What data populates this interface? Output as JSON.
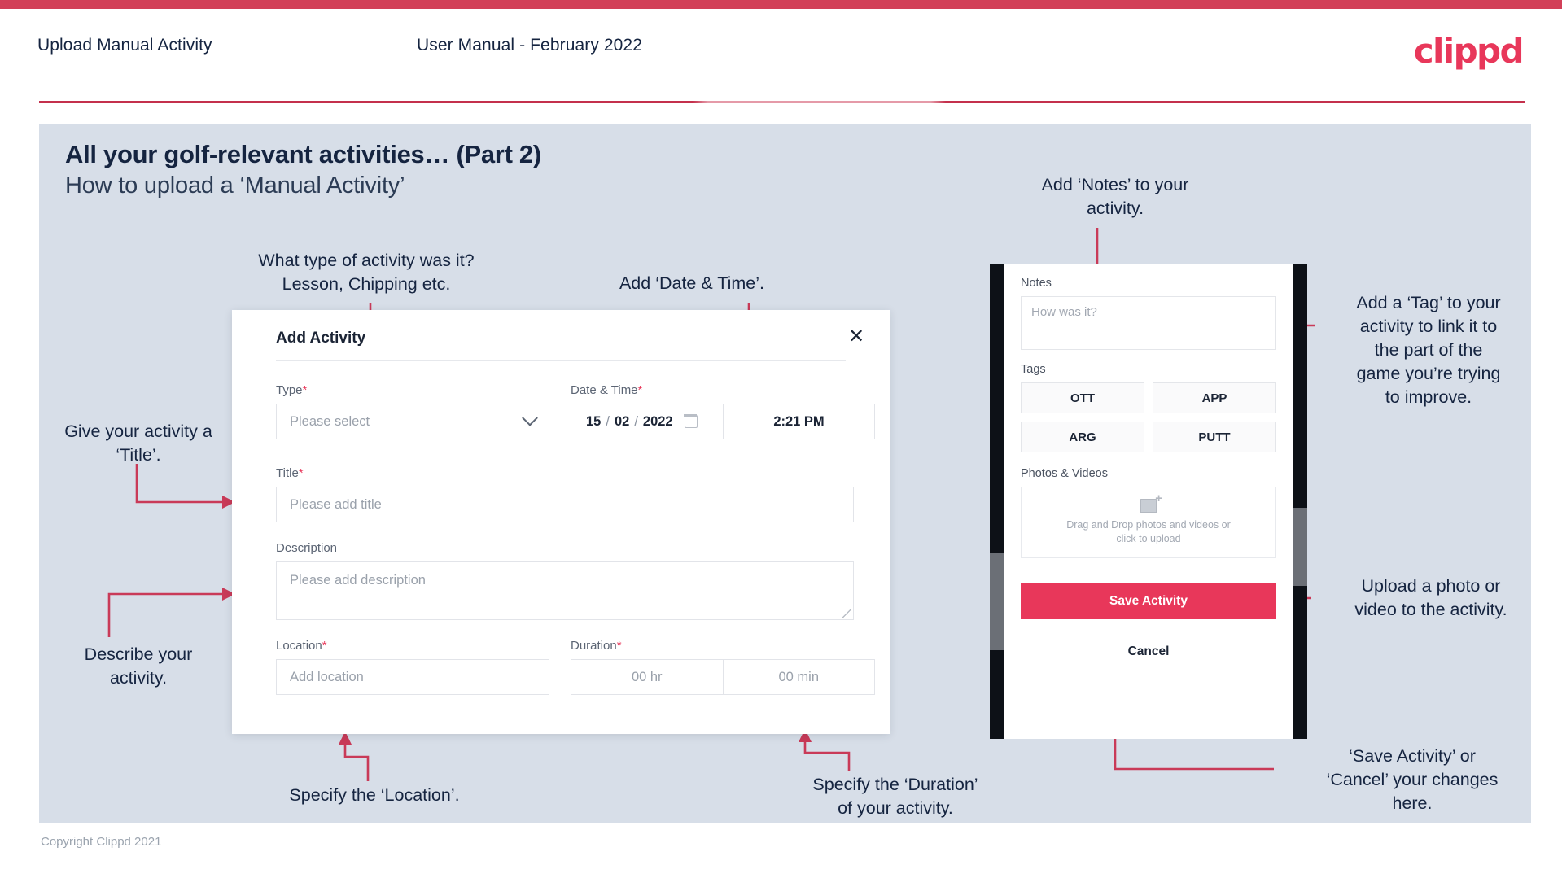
{
  "header": {
    "title": "Upload Manual Activity",
    "subtitle": "User Manual - February 2022",
    "brand": "clippd"
  },
  "slide": {
    "title": "All your golf-relevant activities… (Part 2)",
    "subtitle": "How to upload a ‘Manual Activity’",
    "copyright": "Copyright Clippd 2021"
  },
  "annotations": {
    "type": "What type of activity was it?\nLesson, Chipping etc.",
    "date_time": "Add ‘Date & Time’.",
    "title": "Give your activity a\n‘Title’.",
    "description": "Describe your\nactivity.",
    "location": "Specify the ‘Location’.",
    "duration": "Specify the ‘Duration’\nof your activity.",
    "notes": "Add ‘Notes’ to your\nactivity.",
    "tags": "Add a ‘Tag’ to your\nactivity to link it to\nthe part of the\ngame you’re trying\nto improve.",
    "upload": "Upload a photo or\nvideo to the activity.",
    "save_cancel": "‘Save Activity’ or\n‘Cancel’ your changes\nhere."
  },
  "modal": {
    "title": "Add Activity",
    "close_icon": "close-icon",
    "fields": {
      "type": {
        "label": "Type",
        "required": "*",
        "placeholder": "Please select",
        "icon": "chevron-down-icon"
      },
      "date_time": {
        "label": "Date & Time",
        "required": "*",
        "day": "15",
        "month": "02",
        "year": "2022",
        "sep": "/",
        "time": "2:21 PM",
        "icon": "calendar-icon"
      },
      "title": {
        "label": "Title",
        "required": "*",
        "placeholder": "Please add title"
      },
      "description": {
        "label": "Description",
        "required": "",
        "placeholder": "Please add description"
      },
      "location": {
        "label": "Location",
        "required": "*",
        "placeholder": "Add location"
      },
      "duration": {
        "label": "Duration",
        "required": "*",
        "hours_placeholder": "00 hr",
        "minutes_placeholder": "00 min"
      }
    }
  },
  "phone": {
    "notes": {
      "label": "Notes",
      "placeholder": "How was it?"
    },
    "tags": {
      "label": "Tags",
      "items": [
        "OTT",
        "APP",
        "ARG",
        "PUTT"
      ]
    },
    "photos": {
      "label": "Photos & Videos",
      "icon": "image-add-icon",
      "line1": "Drag and Drop photos and videos or",
      "line2": "click to upload"
    },
    "save_label": "Save Activity",
    "cancel_label": "Cancel"
  },
  "colors": {
    "brand_red": "#e8375a",
    "top_bar": "#d24058",
    "slide_bg": "#d7dee8",
    "text_dark": "#152440",
    "connector": "#c93a58"
  }
}
